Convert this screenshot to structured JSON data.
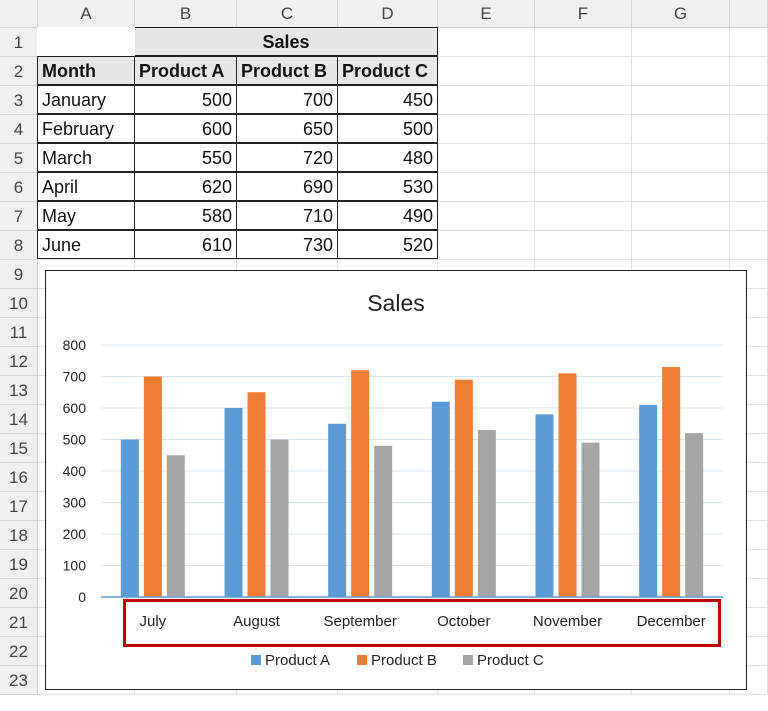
{
  "columns": [
    "A",
    "B",
    "C",
    "D",
    "E",
    "F",
    "G"
  ],
  "rows": [
    "1",
    "2",
    "3",
    "4",
    "5",
    "6",
    "7",
    "8",
    "9",
    "10",
    "11",
    "12",
    "13",
    "14",
    "15",
    "16",
    "17",
    "18",
    "19",
    "20",
    "21",
    "22",
    "23"
  ],
  "table": {
    "group_header": "Sales",
    "headers": [
      "Month",
      "Product A",
      "Product B",
      "Product C"
    ],
    "data": [
      [
        "January",
        "500",
        "700",
        "450"
      ],
      [
        "February",
        "600",
        "650",
        "500"
      ],
      [
        "March",
        "550",
        "720",
        "480"
      ],
      [
        "April",
        "620",
        "690",
        "530"
      ],
      [
        "May",
        "580",
        "710",
        "490"
      ],
      [
        "June",
        "610",
        "730",
        "520"
      ]
    ]
  },
  "chart_data": {
    "type": "bar",
    "title": "Sales",
    "categories": [
      "July",
      "August",
      "September",
      "October",
      "November",
      "December"
    ],
    "series": [
      {
        "name": "Product A",
        "color": "#5b9bd5",
        "values": [
          500,
          600,
          550,
          620,
          580,
          610
        ]
      },
      {
        "name": "Product B",
        "color": "#ed7d31",
        "values": [
          700,
          650,
          720,
          690,
          710,
          730
        ]
      },
      {
        "name": "Product C",
        "color": "#a5a5a5",
        "values": [
          450,
          500,
          480,
          530,
          490,
          520
        ]
      }
    ],
    "ylim": [
      0,
      800
    ],
    "yticks": [
      "0",
      "100",
      "200",
      "300",
      "400",
      "500",
      "600",
      "700",
      "800"
    ],
    "grid": true,
    "legend": "bottom",
    "highlight": "category axis labels boxed in red"
  }
}
